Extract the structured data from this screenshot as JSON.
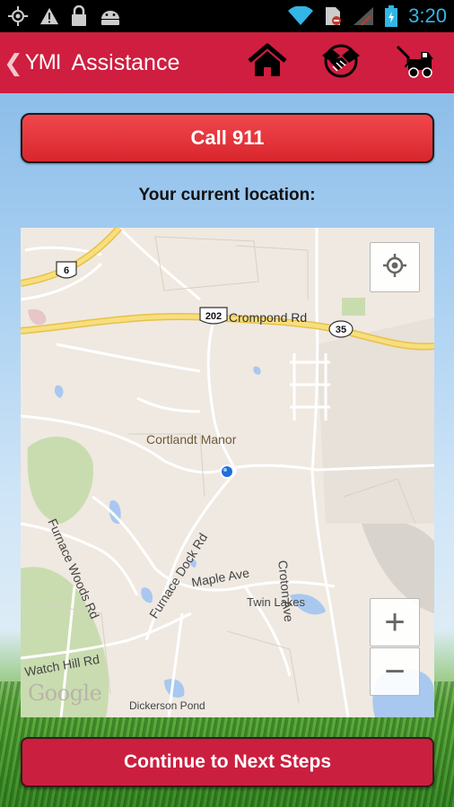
{
  "status_bar": {
    "time": "3:20",
    "left_icons": [
      "gps-icon",
      "warning-icon",
      "lock-icon",
      "android-icon"
    ],
    "right_icons": [
      "wifi-icon",
      "no-sim-icon",
      "signal-icon",
      "battery-icon"
    ]
  },
  "app_bar": {
    "logo": "YMI",
    "title": "Assistance",
    "back_glyph": "❮",
    "actions": [
      "home-icon",
      "handshake-icon",
      "tow-truck-icon"
    ]
  },
  "call_button": {
    "label": "Call 911"
  },
  "location_label": "Your current location:",
  "map": {
    "places": [
      "Cortlandt Manor",
      "Crompond Rd",
      "Maple Ave",
      "Twin Lakes",
      "Croton Ave",
      "Furnace Woods Rd",
      "Furnace Dock Rd",
      "Watch Hill Rd",
      "Dickerson Pond"
    ],
    "route_shields": [
      "6",
      "202",
      "35"
    ],
    "attribution": "Google",
    "zoom_in": "+",
    "zoom_out": "−"
  },
  "continue_button": {
    "label": "Continue to Next Steps"
  },
  "colors": {
    "brand": "#cf1e3f",
    "call": "#e3343a",
    "status_time": "#33b5e5"
  }
}
